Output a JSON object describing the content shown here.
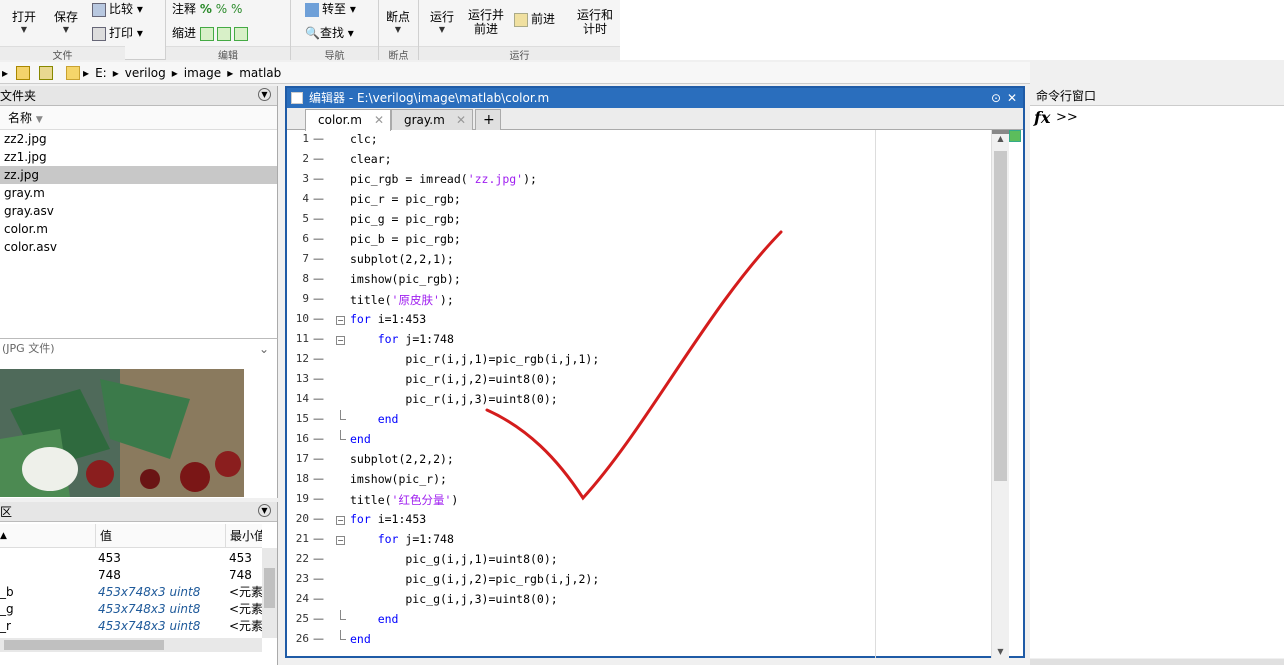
{
  "toolstrip": {
    "open": "打开",
    "save": "保存",
    "compare": "比较",
    "print": "打印",
    "comment": "注释",
    "indent": "缩进",
    "goto": "转至",
    "find": "查找",
    "breakpoints": "断点",
    "run": "运行",
    "run_advance_1": "运行并",
    "run_advance_2": "前进",
    "advance": "前进",
    "run_time_1": "运行和",
    "run_time_2": "计时",
    "grp_file": "文件",
    "grp_edit": "编辑",
    "grp_nav": "导航",
    "grp_bp": "断点",
    "grp_run": "运行"
  },
  "address": {
    "parts": [
      "E:",
      "verilog",
      "image",
      "matlab"
    ]
  },
  "files": {
    "title": "文件夹",
    "col_name": "名称",
    "items": [
      "zz2.jpg",
      "zz1.jpg",
      "zz.jpg",
      "gray.m",
      "gray.asv",
      "color.m",
      "color.asv"
    ],
    "selected_index": 2
  },
  "detail": {
    "label": "(JPG 文件)"
  },
  "workspace": {
    "title": "区",
    "col_value": "值",
    "col_min": "最小值",
    "rows": [
      {
        "name": "",
        "value": "453",
        "min": "453",
        "italic": false
      },
      {
        "name": "",
        "value": "748",
        "min": "748",
        "italic": false
      },
      {
        "name": "_b",
        "value": "453x748x3 uint8",
        "min": "<元素",
        "italic": true
      },
      {
        "name": "_g",
        "value": "453x748x3 uint8",
        "min": "<元素",
        "italic": true
      },
      {
        "name": "_r",
        "value": "453x748x3 uint8",
        "min": "<元素",
        "italic": true
      }
    ]
  },
  "editor": {
    "title": "编辑器 - E:\\verilog\\image\\matlab\\color.m",
    "tabs": [
      "color.m",
      "gray.m"
    ],
    "lines": [
      "clc;",
      "clear;",
      "pic_rgb = imread('zz.jpg');",
      "pic_r = pic_rgb;",
      "pic_g = pic_rgb;",
      "pic_b = pic_rgb;",
      "subplot(2,2,1);",
      "imshow(pic_rgb);",
      "title('原皮肤');",
      "for i=1:453",
      "    for j=1:748",
      "        pic_r(i,j,1)=pic_rgb(i,j,1);",
      "        pic_r(i,j,2)=uint8(0);",
      "        pic_r(i,j,3)=uint8(0);",
      "    end",
      "end",
      "subplot(2,2,2);",
      "imshow(pic_r);",
      "title('红色分量')",
      "for i=1:453",
      "    for j=1:748",
      "        pic_g(i,j,1)=uint8(0);",
      "        pic_g(i,j,2)=pic_rgb(i,j,2);",
      "        pic_g(i,j,3)=uint8(0);",
      "    end",
      "end"
    ],
    "line_numbers": [
      "1",
      "2",
      "3",
      "4",
      "5",
      "6",
      "7",
      "8",
      "9",
      "10",
      "11",
      "12",
      "13",
      "14",
      "15",
      "16",
      "17",
      "18",
      "19",
      "20",
      "21",
      "22",
      "23",
      "24",
      "25",
      "26"
    ]
  },
  "command": {
    "title": "命令行窗口",
    "fx": "fx",
    "prompt": ">>"
  }
}
